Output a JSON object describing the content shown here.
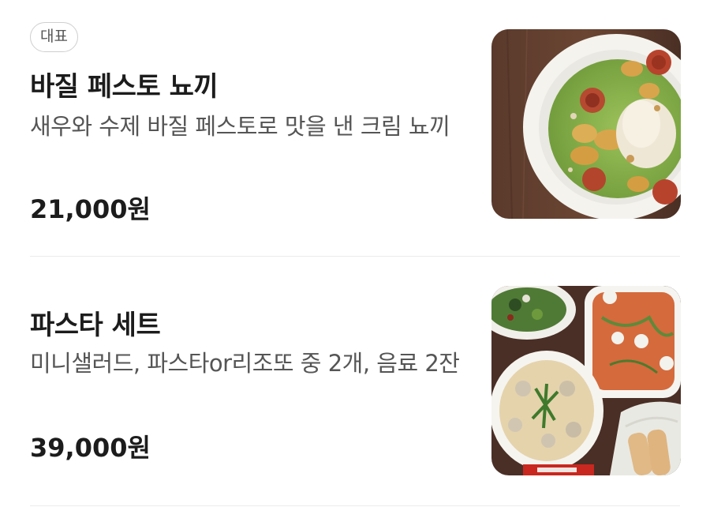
{
  "menu": {
    "items": [
      {
        "badge": "대표",
        "name": "바질 페스토 뇨끼",
        "description": "새우와 수제 바질 페스토로 맛을 낸 크림 뇨끼",
        "price": "21,000원",
        "image_icon": "pesto-gnocchi-photo"
      },
      {
        "name": "파스타 세트",
        "description": "미니샐러드, 파스타or리조또 중 2개, 음료 2잔",
        "price": "39,000원",
        "image_icon": "pasta-set-photo"
      }
    ]
  },
  "colors": {
    "text_primary": "#1c1c1c",
    "text_secondary": "#555555",
    "divider": "#ebebeb",
    "badge_border": "#cfcfcf"
  }
}
